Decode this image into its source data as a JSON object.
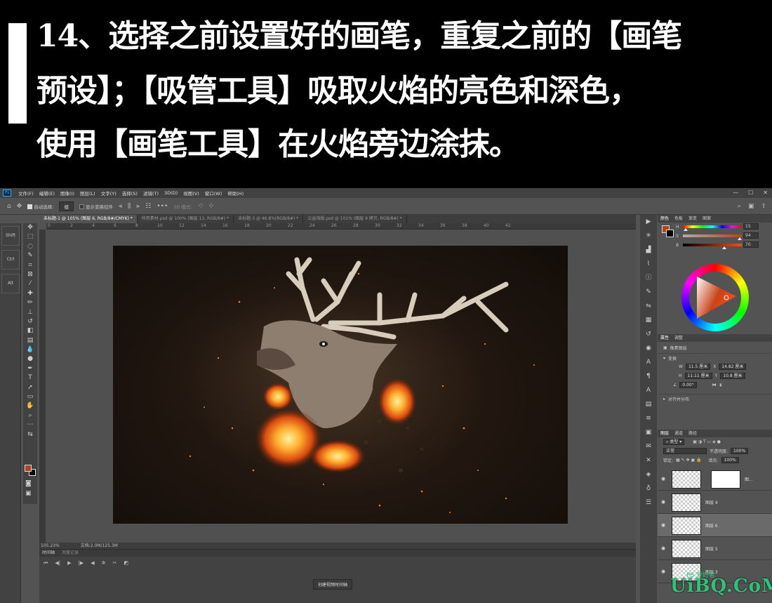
{
  "header": {
    "line1": "14、选择之前设置好的画笔，重复之前的【画笔",
    "line2": "预设】；【吸管工具】吸取火焰的亮色和深色，",
    "line3": "使用【画笔工具】在火焰旁边涂抹。"
  },
  "menubar": {
    "logo": "Ps",
    "items": [
      "文件(F)",
      "编辑(E)",
      "图像(I)",
      "图层(L)",
      "文字(Y)",
      "选择(S)",
      "滤镜(T)",
      "3D(D)",
      "视图(V)",
      "窗口(W)",
      "帮助(H)"
    ]
  },
  "options": {
    "auto_select": "自动选择:",
    "auto_select_value": "组",
    "show_transform": "显示变换控件",
    "mode3d": "3D 模式:"
  },
  "tabs": [
    "未标题-1 @ 105% (图层 6, RGB/8#/CMYK) *",
    "所用素材.psd @ 100% (图层 13, RGB/8#) *",
    "未标题-3 @ 46.8%(RGB/8#) *",
    "公益海报.psd @ 101% (图层 9 拷贝, RGB/8#) *"
  ],
  "left_shortcuts": [
    "Shift",
    "Ctrl",
    "Alt"
  ],
  "ruler_ticks": [
    "0",
    "2",
    "4",
    "6",
    "8",
    "10",
    "12",
    "14",
    "16",
    "18",
    "20",
    "22",
    "24",
    "26",
    "28",
    "30",
    "32",
    "34",
    "36",
    "38",
    "40",
    "42"
  ],
  "status": {
    "zoom": "105.23%",
    "doc": "文档:2.0M/125.3M"
  },
  "timeline": {
    "tab1": "时间轴",
    "tab2": "测量记录",
    "create_button": "创建视频时间轴"
  },
  "color_panel": {
    "tabs": [
      "颜色",
      "色板",
      "渐变",
      "图案"
    ],
    "h_label": "H",
    "h_value": "15",
    "s_label": "S",
    "s_value": "94",
    "b_label": "B",
    "b_value": "70",
    "foreground": "#b5441d",
    "background": "#000000"
  },
  "properties_panel": {
    "tabs": [
      "属性",
      "调整"
    ],
    "layer_type": "像素图层",
    "transform_label": "变换",
    "w_label": "W",
    "w_value": "11.5 厘米",
    "x_label": "X",
    "x_value": "14.82 厘米",
    "h_label": "H",
    "h_value": "11.11 厘米",
    "y_label": "Y",
    "y_value": "10.8 厘米",
    "angle": "0.00°",
    "align_label": "对齐并分布"
  },
  "layers_panel": {
    "tabs": [
      "图层",
      "通道",
      "路径"
    ],
    "filter": "类型",
    "blend_mode": "正常",
    "opacity_label": "不透明度:",
    "opacity": "100%",
    "lock_label": "锁定:",
    "fill_label": "填充:",
    "fill": "100%",
    "layers": [
      {
        "name": "图...",
        "has_mask": true,
        "selected": false
      },
      {
        "name": "图层 4",
        "has_mask": false,
        "selected": false
      },
      {
        "name": "图层 6",
        "has_mask": false,
        "selected": true
      },
      {
        "name": "图层 5",
        "has_mask": false,
        "selected": false
      },
      {
        "name": "图层 3",
        "has_mask": false,
        "selected": false
      }
    ]
  },
  "watermark": {
    "main": "UiBQ.CoM",
    "sub": "PS 爱好者"
  }
}
